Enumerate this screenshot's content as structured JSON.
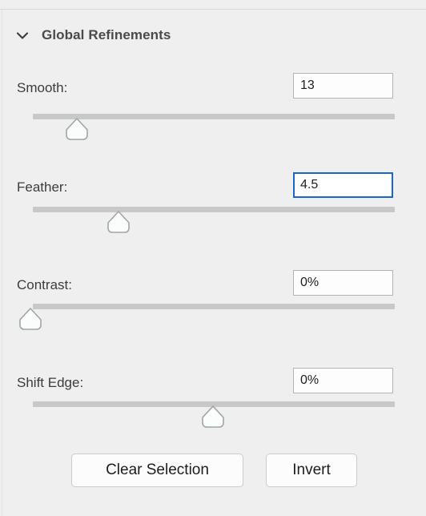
{
  "panel": {
    "section": {
      "title": "Global Refinements",
      "expanded": true,
      "chevron_icon": "chevron-down-icon"
    },
    "colors": {
      "background": "#efefef",
      "label_text": "#3c3c3c",
      "title_text": "#4a4a4a",
      "track": "#c8c8c8",
      "handle_fill": "#fbfdfd",
      "handle_border": "#a0a6a6",
      "input_border": "#b4b4b4",
      "focus_border": "#1668cf",
      "button_face": "#fcfcfc",
      "button_border": "#cccccc",
      "divider": "#d7d7d7"
    },
    "sliders": [
      {
        "label": "Smooth:",
        "value": "13",
        "placeholder": "0",
        "focused": false,
        "handle_percent": 12,
        "range": [
          0,
          100
        ]
      },
      {
        "label": "Feather:",
        "value": "4.5",
        "placeholder": "0",
        "focused": true,
        "handle_percent": 24,
        "range": [
          0,
          100
        ]
      },
      {
        "label": "Contrast:",
        "value": "0%",
        "placeholder": "0%",
        "focused": false,
        "handle_percent": 0,
        "range": [
          0,
          100
        ]
      },
      {
        "label": "Shift Edge:",
        "value": "0%",
        "placeholder": "0%",
        "focused": false,
        "handle_percent": 50,
        "range": [
          -100,
          100
        ]
      }
    ],
    "buttons": {
      "clear_selection": "Clear Selection",
      "invert": "Invert"
    }
  }
}
